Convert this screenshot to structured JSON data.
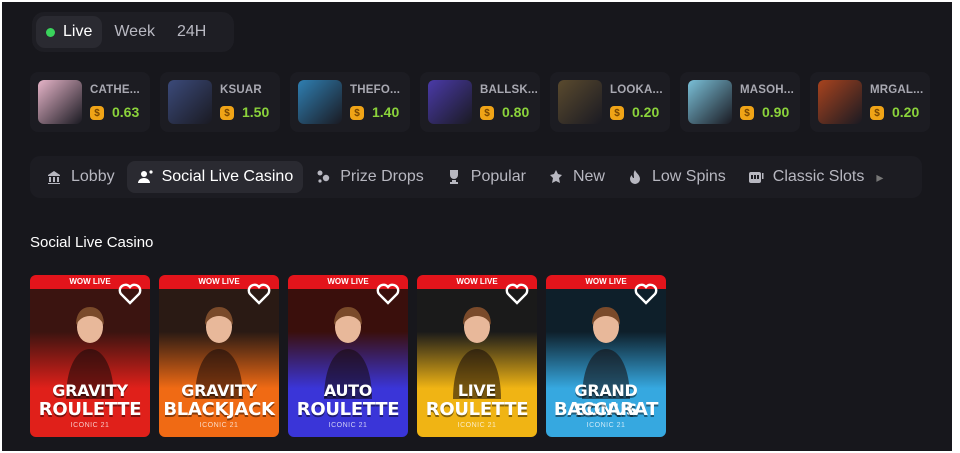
{
  "time_tabs": [
    {
      "label": "Live",
      "active": true
    },
    {
      "label": "Week",
      "active": false
    },
    {
      "label": "24H",
      "active": false
    }
  ],
  "winners": [
    {
      "name": "CATHE...",
      "amount": "0.63",
      "thumb_color": "#e6b4c8"
    },
    {
      "name": "KSUAR",
      "amount": "1.50",
      "thumb_color": "#3b4a7a"
    },
    {
      "name": "THEFO...",
      "amount": "1.40",
      "thumb_color": "#2f7fb2"
    },
    {
      "name": "BALLSK...",
      "amount": "0.80",
      "thumb_color": "#4a3aa8"
    },
    {
      "name": "LOOKA...",
      "amount": "0.20",
      "thumb_color": "#5a4a2e"
    },
    {
      "name": "MASOH...",
      "amount": "0.90",
      "thumb_color": "#7ac0d8"
    },
    {
      "name": "MRGAL...",
      "amount": "0.20",
      "thumb_color": "#a8431e"
    }
  ],
  "coin_symbol": "$",
  "categories": [
    {
      "label": "Lobby",
      "icon": "lobby-icon",
      "active": false
    },
    {
      "label": "Social Live Casino",
      "icon": "live-user-icon",
      "active": true
    },
    {
      "label": "Prize Drops",
      "icon": "prize-drops-icon",
      "active": false
    },
    {
      "label": "Popular",
      "icon": "trophy-icon",
      "active": false
    },
    {
      "label": "New",
      "icon": "new-icon",
      "active": false
    },
    {
      "label": "Low Spins",
      "icon": "flame-icon",
      "active": false
    },
    {
      "label": "Classic Slots",
      "icon": "slot-machine-icon",
      "active": false
    }
  ],
  "section_title": "Social Live Casino",
  "games": [
    {
      "banner": "WOW LIVE",
      "title_line1": "GRAVITY",
      "title_line2": "ROULETTE",
      "provider": "ICONIC 21",
      "bg_top": "#3b1410",
      "bg_bottom": "#e0201a"
    },
    {
      "banner": "WOW LIVE",
      "title_line1": "GRAVITY",
      "title_line2": "BLACKJACK",
      "provider": "ICONIC 21",
      "bg_top": "#2a1a14",
      "bg_bottom": "#f06a14"
    },
    {
      "banner": "WOW LIVE",
      "title_line1": "AUTO",
      "title_line2": "ROULETTE",
      "provider": "ICONIC 21",
      "bg_top": "#3a0f0c",
      "bg_bottom": "#3a35d8"
    },
    {
      "banner": "WOW LIVE",
      "title_line1": "LIVE",
      "title_line2": "ROULETTE",
      "provider": "ICONIC 21",
      "bg_top": "#1a1a1a",
      "bg_bottom": "#f0b414"
    },
    {
      "banner": "WOW LIVE",
      "title_line1": "GRAND BONUS",
      "title_line2": "BACCARAT",
      "provider": "ICONIC 21",
      "bg_top": "#0e1f2a",
      "bg_bottom": "#36a8e0"
    }
  ]
}
